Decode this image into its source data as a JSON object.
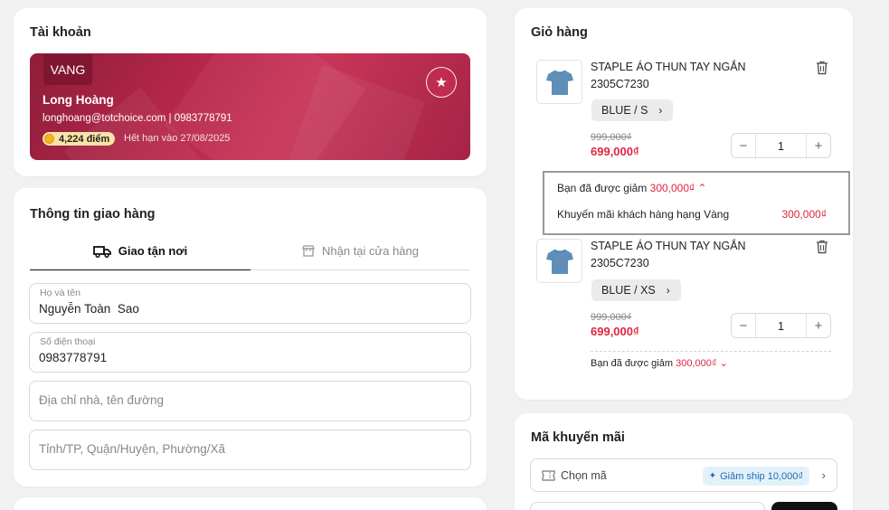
{
  "account": {
    "title": "Tài khoản",
    "tier": "VANG",
    "name": "Long Hoàng",
    "contact": "longhoang@totchoice.com | 0983778791",
    "points": "4,224 điểm",
    "expiry": "Hết hạn vào 27/08/2025",
    "brand_color": "#b8284c"
  },
  "shipping": {
    "title": "Thông tin giao hàng",
    "tabs": [
      {
        "label": "Giao tận nơi",
        "icon": "truck-icon",
        "active": true
      },
      {
        "label": "Nhận tại cửa hàng",
        "icon": "store-icon",
        "active": false
      }
    ],
    "fields": {
      "name": {
        "label": "Họ và tên",
        "value": "Nguyễn Toàn  Sao"
      },
      "phone": {
        "label": "Số điện thoại",
        "value": "0983778791"
      },
      "address": {
        "placeholder": "Địa chỉ nhà, tên đường"
      },
      "region": {
        "placeholder": "Tỉnh/TP, Quận/Huyện, Phường/Xã"
      }
    }
  },
  "cart": {
    "title": "Giỏ hàng",
    "items": [
      {
        "name": "STAPLE ÁO THUN TAY NGẮN 2305C7230",
        "variant": "BLUE / S",
        "old_price": "999,000₫",
        "price": "699,000₫",
        "qty": "1"
      },
      {
        "name": "STAPLE ÁO THUN TAY NGẮN 2305C7230",
        "variant": "BLUE / XS",
        "old_price": "999,000₫",
        "price": "699,000₫",
        "qty": "1"
      }
    ],
    "discount_popup": {
      "label": "Bạn đã được giảm",
      "amount": "300,000₫",
      "detail_label": "Khuyến mãi khách hàng hạng Vàng",
      "detail_amount": "300,000₫"
    },
    "item2_discount": {
      "label": "Bạn đã được giảm",
      "amount": "300,000₫"
    },
    "price_color": "#e0263f"
  },
  "promo": {
    "title": "Mã khuyến mãi",
    "select_label": "Chọn mã",
    "chip": "Giảm ship 10,000₫"
  }
}
